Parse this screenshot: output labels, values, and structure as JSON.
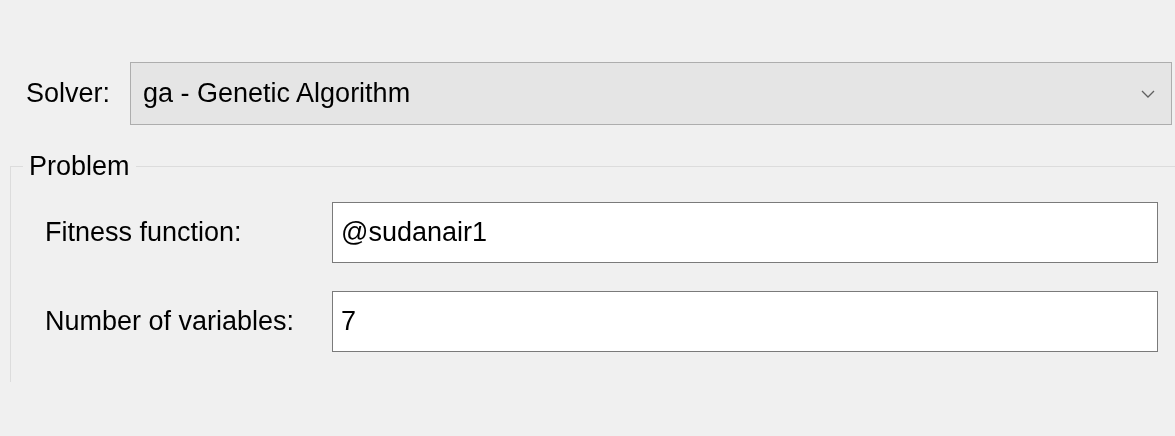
{
  "solver": {
    "label": "Solver:",
    "value": "ga - Genetic Algorithm"
  },
  "problem": {
    "title": "Problem",
    "fields": [
      {
        "label": "Fitness function:",
        "value": "@sudanair1"
      },
      {
        "label": "Number of variables:",
        "value": "7"
      }
    ]
  }
}
